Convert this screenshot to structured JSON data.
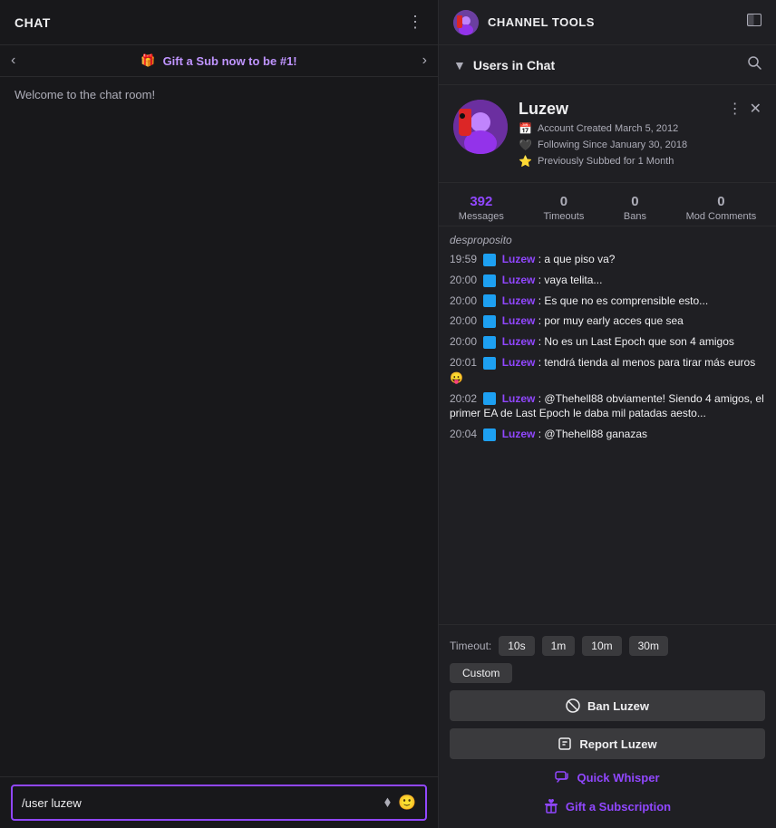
{
  "chat": {
    "title": "CHAT",
    "three_dots": "⋮",
    "gift_banner": {
      "icon": "🎁",
      "text": "Gift a Sub now to be #1!"
    },
    "welcome": "Welcome to the chat room!",
    "input_placeholder": "/user luzew",
    "input_value": "/user luzew"
  },
  "channel_tools": {
    "header_title": "CHANNEL TOOLS",
    "users_in_chat_title": "Users in Chat",
    "user": {
      "name": "Luzew",
      "account_created": "Account Created March 5, 2012",
      "following_since": "Following Since January 30, 2018",
      "prev_subbed": "Previously Subbed for 1 Month",
      "stats": {
        "messages": {
          "value": "392",
          "label": "Messages"
        },
        "timeouts": {
          "value": "0",
          "label": "Timeouts"
        },
        "bans": {
          "value": "0",
          "label": "Bans"
        },
        "mod_comments": {
          "value": "0",
          "label": "Mod Comments"
        }
      }
    },
    "chat_log": [
      {
        "time": "19:59",
        "user": "Luzew",
        "msg": ": a que piso va?"
      },
      {
        "time": "20:00",
        "user": "Luzew",
        "msg": ": vaya telita..."
      },
      {
        "time": "20:00",
        "user": "Luzew",
        "msg": ": Es que no es comprensible esto..."
      },
      {
        "time": "20:00",
        "user": "Luzew",
        "msg": ": por muy early acces que sea"
      },
      {
        "time": "20:00",
        "user": "Luzew",
        "msg": ": No es un Last Epoch que son 4 amigos"
      },
      {
        "time": "20:01",
        "user": "Luzew",
        "msg": ": tendrá tienda al menos para tirar más euros 😛"
      },
      {
        "time": "20:02",
        "user": "Luzew",
        "msg": ": @Thehell88 obviamente! Siendo 4 amigos, el primer EA de Last Epoch le daba mil patadas aesto..."
      },
      {
        "time": "20:04",
        "user": "Luzew",
        "msg": ": @Thehell88 ganazas"
      }
    ],
    "timeout": {
      "label": "Timeout:",
      "options": [
        "10s",
        "1m",
        "10m",
        "30m"
      ],
      "custom_label": "Custom"
    },
    "ban_label": "Ban Luzew",
    "report_label": "Report Luzew",
    "quick_whisper_label": "Quick Whisper",
    "gift_sub_label": "Gift a Subscription",
    "faded_text": "desproposito"
  }
}
